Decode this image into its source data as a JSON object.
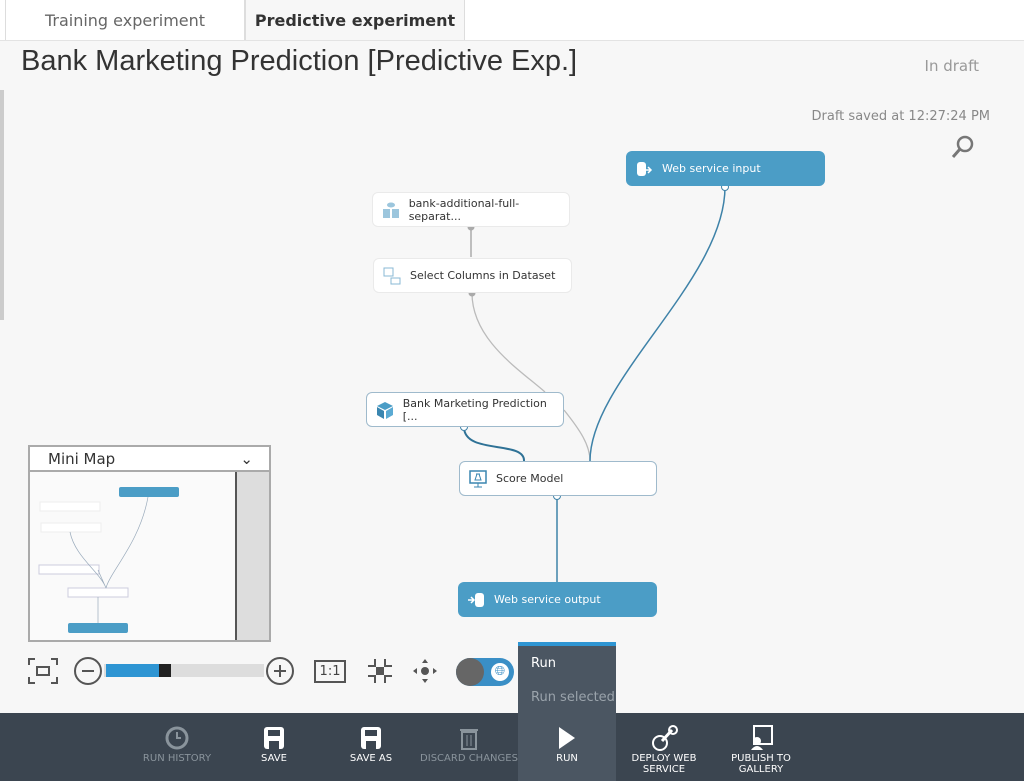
{
  "tabs": [
    {
      "label": "Training experiment",
      "active": false
    },
    {
      "label": "Predictive experiment",
      "active": true
    }
  ],
  "header": {
    "title": "Bank Marketing Prediction [Predictive Exp.]",
    "status": "In draft",
    "saved": "Draft saved at 12:27:24 PM"
  },
  "nodes": {
    "dataset": "bank-additional-full-separat...",
    "select": "Select Columns in Dataset",
    "ws_input": "Web service input",
    "model": "Bank Marketing Prediction [...",
    "score": "Score Model",
    "ws_output": "Web service output"
  },
  "minimap": {
    "title": "Mini Map"
  },
  "zoom": {
    "level_fraction": 0.35,
    "one_to_one": "1:1"
  },
  "run_menu": {
    "run": "Run",
    "run_selected": "Run selected"
  },
  "toolbar": {
    "run_history": "RUN HISTORY",
    "save": "SAVE",
    "save_as": "SAVE AS",
    "discard": "DISCARD CHANGES",
    "run": "RUN",
    "deploy": "DEPLOY WEB SERVICE",
    "publish": "PUBLISH TO GALLERY"
  },
  "colors": {
    "accent": "#2e95d3",
    "node_blue": "#4b9dc6",
    "toolbar": "#3b4550"
  }
}
